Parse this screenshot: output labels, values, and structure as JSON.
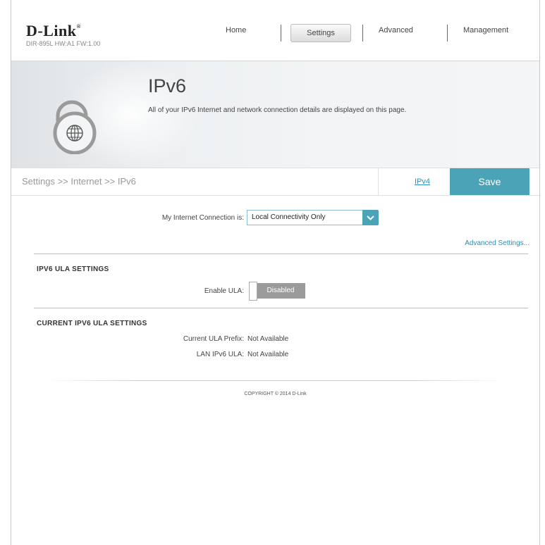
{
  "brand": {
    "logo": "D-Link",
    "device_info": "DIR-895L  HW:A1  FW:1.00"
  },
  "nav": {
    "home": "Home",
    "settings": "Settings",
    "advanced": "Advanced",
    "management": "Management"
  },
  "banner": {
    "title": "IPv6",
    "description": "All of your IPv6 Internet and network connection details are displayed on this page."
  },
  "breadcrumb": "Settings >> Internet >> IPv6",
  "actions": {
    "ipv4_link": "IPv4",
    "save": "Save"
  },
  "connection": {
    "label": "My Internet Connection is:",
    "selected": "Local Connectivity Only"
  },
  "advanced_settings_link": "Advanced Settings...",
  "ula_settings": {
    "title": "IPV6 ULA SETTINGS",
    "enable_label": "Enable ULA:",
    "enable_state": "Disabled"
  },
  "current_ula": {
    "title": "CURRENT IPV6 ULA SETTINGS",
    "prefix_label": "Current ULA Prefix:",
    "prefix_value": "Not Available",
    "lan_label": "LAN IPv6 ULA:",
    "lan_value": "Not Available"
  },
  "footer": {
    "copyright": "COPYRIGHT © 2014 D-Link"
  },
  "colors": {
    "accent": "#4aa3b6",
    "link": "#2a8fb3",
    "toggle_off": "#9b9b9b"
  }
}
